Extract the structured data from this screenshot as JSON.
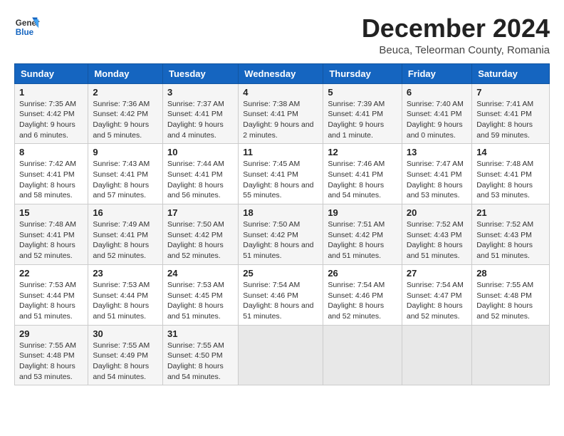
{
  "header": {
    "logo_line1": "General",
    "logo_line2": "Blue",
    "main_title": "December 2024",
    "subtitle": "Beuca, Teleorman County, Romania"
  },
  "weekdays": [
    "Sunday",
    "Monday",
    "Tuesday",
    "Wednesday",
    "Thursday",
    "Friday",
    "Saturday"
  ],
  "weeks": [
    [
      {
        "day": "1",
        "sunrise": "Sunrise: 7:35 AM",
        "sunset": "Sunset: 4:42 PM",
        "daylight": "Daylight: 9 hours and 6 minutes."
      },
      {
        "day": "2",
        "sunrise": "Sunrise: 7:36 AM",
        "sunset": "Sunset: 4:42 PM",
        "daylight": "Daylight: 9 hours and 5 minutes."
      },
      {
        "day": "3",
        "sunrise": "Sunrise: 7:37 AM",
        "sunset": "Sunset: 4:41 PM",
        "daylight": "Daylight: 9 hours and 4 minutes."
      },
      {
        "day": "4",
        "sunrise": "Sunrise: 7:38 AM",
        "sunset": "Sunset: 4:41 PM",
        "daylight": "Daylight: 9 hours and 2 minutes."
      },
      {
        "day": "5",
        "sunrise": "Sunrise: 7:39 AM",
        "sunset": "Sunset: 4:41 PM",
        "daylight": "Daylight: 9 hours and 1 minute."
      },
      {
        "day": "6",
        "sunrise": "Sunrise: 7:40 AM",
        "sunset": "Sunset: 4:41 PM",
        "daylight": "Daylight: 9 hours and 0 minutes."
      },
      {
        "day": "7",
        "sunrise": "Sunrise: 7:41 AM",
        "sunset": "Sunset: 4:41 PM",
        "daylight": "Daylight: 8 hours and 59 minutes."
      }
    ],
    [
      {
        "day": "8",
        "sunrise": "Sunrise: 7:42 AM",
        "sunset": "Sunset: 4:41 PM",
        "daylight": "Daylight: 8 hours and 58 minutes."
      },
      {
        "day": "9",
        "sunrise": "Sunrise: 7:43 AM",
        "sunset": "Sunset: 4:41 PM",
        "daylight": "Daylight: 8 hours and 57 minutes."
      },
      {
        "day": "10",
        "sunrise": "Sunrise: 7:44 AM",
        "sunset": "Sunset: 4:41 PM",
        "daylight": "Daylight: 8 hours and 56 minutes."
      },
      {
        "day": "11",
        "sunrise": "Sunrise: 7:45 AM",
        "sunset": "Sunset: 4:41 PM",
        "daylight": "Daylight: 8 hours and 55 minutes."
      },
      {
        "day": "12",
        "sunrise": "Sunrise: 7:46 AM",
        "sunset": "Sunset: 4:41 PM",
        "daylight": "Daylight: 8 hours and 54 minutes."
      },
      {
        "day": "13",
        "sunrise": "Sunrise: 7:47 AM",
        "sunset": "Sunset: 4:41 PM",
        "daylight": "Daylight: 8 hours and 53 minutes."
      },
      {
        "day": "14",
        "sunrise": "Sunrise: 7:48 AM",
        "sunset": "Sunset: 4:41 PM",
        "daylight": "Daylight: 8 hours and 53 minutes."
      }
    ],
    [
      {
        "day": "15",
        "sunrise": "Sunrise: 7:48 AM",
        "sunset": "Sunset: 4:41 PM",
        "daylight": "Daylight: 8 hours and 52 minutes."
      },
      {
        "day": "16",
        "sunrise": "Sunrise: 7:49 AM",
        "sunset": "Sunset: 4:41 PM",
        "daylight": "Daylight: 8 hours and 52 minutes."
      },
      {
        "day": "17",
        "sunrise": "Sunrise: 7:50 AM",
        "sunset": "Sunset: 4:42 PM",
        "daylight": "Daylight: 8 hours and 52 minutes."
      },
      {
        "day": "18",
        "sunrise": "Sunrise: 7:50 AM",
        "sunset": "Sunset: 4:42 PM",
        "daylight": "Daylight: 8 hours and 51 minutes."
      },
      {
        "day": "19",
        "sunrise": "Sunrise: 7:51 AM",
        "sunset": "Sunset: 4:42 PM",
        "daylight": "Daylight: 8 hours and 51 minutes."
      },
      {
        "day": "20",
        "sunrise": "Sunrise: 7:52 AM",
        "sunset": "Sunset: 4:43 PM",
        "daylight": "Daylight: 8 hours and 51 minutes."
      },
      {
        "day": "21",
        "sunrise": "Sunrise: 7:52 AM",
        "sunset": "Sunset: 4:43 PM",
        "daylight": "Daylight: 8 hours and 51 minutes."
      }
    ],
    [
      {
        "day": "22",
        "sunrise": "Sunrise: 7:53 AM",
        "sunset": "Sunset: 4:44 PM",
        "daylight": "Daylight: 8 hours and 51 minutes."
      },
      {
        "day": "23",
        "sunrise": "Sunrise: 7:53 AM",
        "sunset": "Sunset: 4:44 PM",
        "daylight": "Daylight: 8 hours and 51 minutes."
      },
      {
        "day": "24",
        "sunrise": "Sunrise: 7:53 AM",
        "sunset": "Sunset: 4:45 PM",
        "daylight": "Daylight: 8 hours and 51 minutes."
      },
      {
        "day": "25",
        "sunrise": "Sunrise: 7:54 AM",
        "sunset": "Sunset: 4:46 PM",
        "daylight": "Daylight: 8 hours and 51 minutes."
      },
      {
        "day": "26",
        "sunrise": "Sunrise: 7:54 AM",
        "sunset": "Sunset: 4:46 PM",
        "daylight": "Daylight: 8 hours and 52 minutes."
      },
      {
        "day": "27",
        "sunrise": "Sunrise: 7:54 AM",
        "sunset": "Sunset: 4:47 PM",
        "daylight": "Daylight: 8 hours and 52 minutes."
      },
      {
        "day": "28",
        "sunrise": "Sunrise: 7:55 AM",
        "sunset": "Sunset: 4:48 PM",
        "daylight": "Daylight: 8 hours and 52 minutes."
      }
    ],
    [
      {
        "day": "29",
        "sunrise": "Sunrise: 7:55 AM",
        "sunset": "Sunset: 4:48 PM",
        "daylight": "Daylight: 8 hours and 53 minutes."
      },
      {
        "day": "30",
        "sunrise": "Sunrise: 7:55 AM",
        "sunset": "Sunset: 4:49 PM",
        "daylight": "Daylight: 8 hours and 54 minutes."
      },
      {
        "day": "31",
        "sunrise": "Sunrise: 7:55 AM",
        "sunset": "Sunset: 4:50 PM",
        "daylight": "Daylight: 8 hours and 54 minutes."
      },
      null,
      null,
      null,
      null
    ]
  ]
}
